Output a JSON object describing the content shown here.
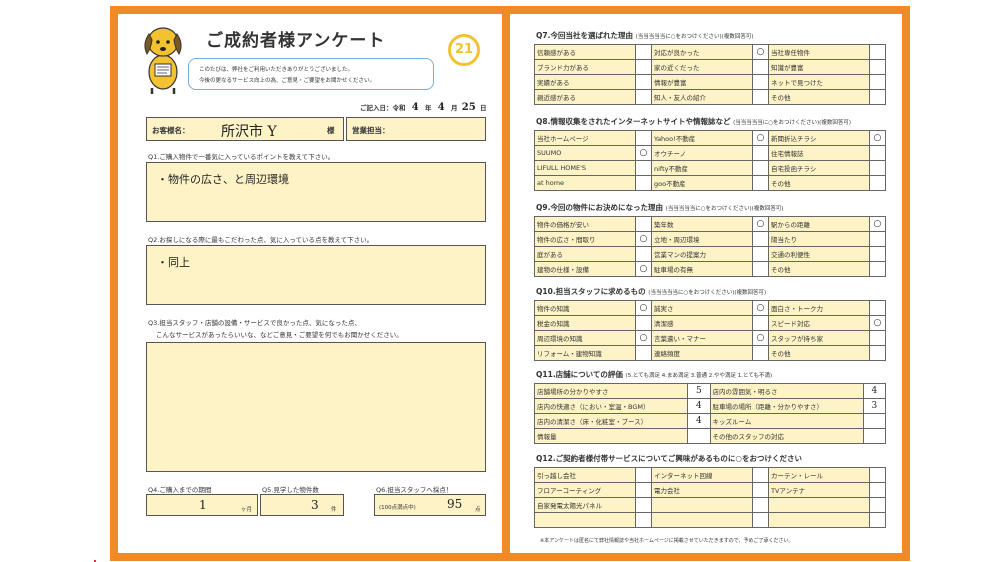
{
  "left": {
    "title": "ご成約者様アンケート",
    "intro_line1": "このたびは、弊社をご利用いただきありがとうございました。",
    "intro_line2": "今後の更なるサービス向上の為、ご意見・ご要望をお聞かせください。",
    "logo_text": "21",
    "date": {
      "label": "ご記入日：令和",
      "year": "4",
      "year_unit": "年",
      "month": "4",
      "month_unit": "月",
      "day": "25",
      "day_unit": "日"
    },
    "customer": {
      "label": "お客様名：",
      "value": "所沢市 Y",
      "suffix": "様"
    },
    "staff": {
      "label": "営業担当："
    },
    "q1": {
      "text": "Q1.ご購入物件で一番気に入っているポイントを教えて下さい。",
      "answer": "・物件の広さ、と周辺環境"
    },
    "q2": {
      "text": "Q2.お探しになる際に最もこだわった点、気に入っている点を教えて下さい。",
      "answer": "・同上"
    },
    "q3": {
      "line1": "Q3.担当スタッフ・店舗の設備・サービスで良かった点、気になった点、",
      "line2": "こんなサービスがあったらいいな、などご意見・ご要望を何でもお聞かせください。"
    },
    "q4": {
      "text": "Q4.ご購入までの期間",
      "value": "1",
      "unit": "ヶ月"
    },
    "q5": {
      "text": "Q5.見学した物件数",
      "value": "3",
      "unit": "件"
    },
    "q6": {
      "text": "Q6.担当スタッフへ採点！",
      "hint": "(100点満点中)",
      "value": "95",
      "unit": "点"
    }
  },
  "right": {
    "q7": {
      "title": "Q7.今回当社を選ばれた理由",
      "note": "(当当当当当に○をおつけください)(複数回答可)",
      "rows": [
        [
          {
            "label": "信頼感がある",
            "mark": ""
          },
          {
            "label": "対応が良かった",
            "mark": "○"
          },
          {
            "label": "当社専任物件",
            "mark": ""
          }
        ],
        [
          {
            "label": "ブランド力がある",
            "mark": ""
          },
          {
            "label": "家の近くだった",
            "mark": ""
          },
          {
            "label": "知識が豊富",
            "mark": ""
          }
        ],
        [
          {
            "label": "実績がある",
            "mark": ""
          },
          {
            "label": "情報が豊富",
            "mark": ""
          },
          {
            "label": "ネットで見つけた",
            "mark": ""
          }
        ],
        [
          {
            "label": "親近感がある",
            "mark": ""
          },
          {
            "label": "知人・友人の紹介",
            "mark": ""
          },
          {
            "label": "その他",
            "mark": ""
          }
        ]
      ]
    },
    "q8": {
      "title": "Q8.情報収集をされたインターネットサイトや情報誌など",
      "note": "(当当当当当に○をおつけください)(複数回答可)",
      "rows": [
        [
          {
            "label": "当社ホームページ",
            "mark": ""
          },
          {
            "label": "Yahoo!不動産",
            "mark": "○"
          },
          {
            "label": "新聞折込チラシ",
            "mark": "○"
          }
        ],
        [
          {
            "label": "SUUMO",
            "mark": "○"
          },
          {
            "label": "オウチーノ",
            "mark": ""
          },
          {
            "label": "住宅情報誌",
            "mark": ""
          }
        ],
        [
          {
            "label": "LIFULL HOME'S",
            "mark": ""
          },
          {
            "label": "nifty不動産",
            "mark": ""
          },
          {
            "label": "自宅投函チラシ",
            "mark": ""
          }
        ],
        [
          {
            "label": "at home",
            "mark": ""
          },
          {
            "label": "goo不動産",
            "mark": ""
          },
          {
            "label": "その他",
            "mark": ""
          }
        ]
      ]
    },
    "q9": {
      "title": "Q9.今回の物件にお決めになった理由",
      "note": "(当当当当当に○をおつけください)(複数回答可)",
      "rows": [
        [
          {
            "label": "物件の価格が安い",
            "mark": ""
          },
          {
            "label": "築年数",
            "mark": "○"
          },
          {
            "label": "駅からの距離",
            "mark": "○"
          }
        ],
        [
          {
            "label": "物件の広さ・間取り",
            "mark": "○"
          },
          {
            "label": "立地・周辺環境",
            "mark": ""
          },
          {
            "label": "陽当たり",
            "mark": ""
          }
        ],
        [
          {
            "label": "庭がある",
            "mark": ""
          },
          {
            "label": "営業マンの提案力",
            "mark": ""
          },
          {
            "label": "交通の利便性",
            "mark": ""
          }
        ],
        [
          {
            "label": "建物の仕様・設備",
            "mark": "○"
          },
          {
            "label": "駐車場の有無",
            "mark": ""
          },
          {
            "label": "その他",
            "mark": ""
          }
        ]
      ]
    },
    "q10": {
      "title": "Q10.担当スタッフに求めるもの",
      "note": "(当当当当当に○をおつけください)(複数回答可)",
      "rows": [
        [
          {
            "label": "物件の知識",
            "mark": "○"
          },
          {
            "label": "誠実さ",
            "mark": "○"
          },
          {
            "label": "面白さ・トーク力",
            "mark": ""
          }
        ],
        [
          {
            "label": "税金の知識",
            "mark": ""
          },
          {
            "label": "清潔感",
            "mark": ""
          },
          {
            "label": "スピード対応",
            "mark": "○"
          }
        ],
        [
          {
            "label": "周辺環境の知識",
            "mark": "○"
          },
          {
            "label": "言葉遣い・マナー",
            "mark": "○"
          },
          {
            "label": "スタッフが持ち家",
            "mark": ""
          }
        ],
        [
          {
            "label": "リフォーム・建物知識",
            "mark": ""
          },
          {
            "label": "連絡頻度",
            "mark": ""
          },
          {
            "label": "その他",
            "mark": ""
          }
        ]
      ]
    },
    "q11": {
      "title": "Q11.店舗についての評価",
      "scale": "(5.とても満足  4.まあ満足  3.普通  2.やや満足  1.とても不満)",
      "rows": [
        [
          {
            "label": "店舗場所の分かりやすさ",
            "mark": "5"
          },
          {
            "label": "店内の雰囲気・明るさ",
            "mark": "4"
          }
        ],
        [
          {
            "label": "店内の快適さ（におい・室温・BGM）",
            "mark": "4"
          },
          {
            "label": "駐車場の場所（距離・分かりやすさ）",
            "mark": "3"
          }
        ],
        [
          {
            "label": "店内の清潔さ（床・化粧室・ブース）",
            "mark": "4"
          },
          {
            "label": "キッズルーム",
            "mark": ""
          }
        ],
        [
          {
            "label": "情報量",
            "mark": ""
          },
          {
            "label": "その他のスタッフの対応",
            "mark": ""
          }
        ]
      ]
    },
    "q12": {
      "title": "Q12.ご契約者様付帯サービスについてご興味があるものに○をおつけください",
      "rows": [
        [
          {
            "label": "引っ越し会社",
            "mark": ""
          },
          {
            "label": "インターネット回線",
            "mark": ""
          },
          {
            "label": "カーテン・レール",
            "mark": ""
          }
        ],
        [
          {
            "label": "フロアーコーティング",
            "mark": ""
          },
          {
            "label": "電力会社",
            "mark": ""
          },
          {
            "label": "TVアンテナ",
            "mark": ""
          }
        ],
        [
          {
            "label": "自家発電太陽光パネル",
            "mark": ""
          },
          {
            "label": "",
            "mark": ""
          },
          {
            "label": "",
            "mark": ""
          }
        ],
        [
          {
            "label": "",
            "mark": ""
          },
          {
            "label": "",
            "mark": ""
          },
          {
            "label": "",
            "mark": ""
          }
        ]
      ]
    },
    "footer": "※本アンケートは匿名にて弊社情報誌や当社ホームページに掲載させていただきますので、予めご了承ください。"
  },
  "colors": {
    "frame": "#f08a24",
    "cell_fill": "#fdf3c6",
    "mascot": "#f2c230",
    "logo": "#f2c230"
  }
}
